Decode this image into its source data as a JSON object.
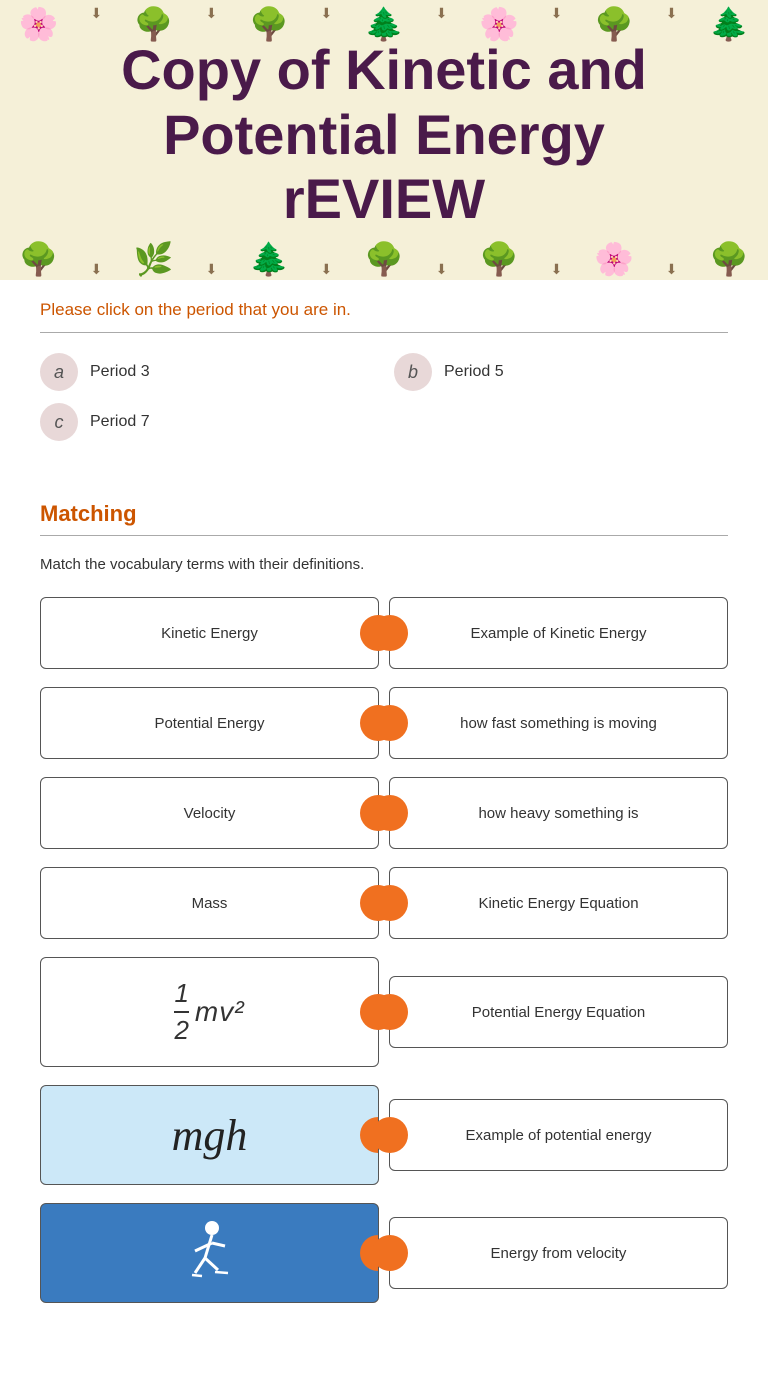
{
  "header": {
    "title": "Copy of Kinetic and Potential Energy rEVIEW"
  },
  "period_section": {
    "prompt": "Please click on the period that you are in.",
    "options": [
      {
        "badge": "a",
        "label": "Period 3"
      },
      {
        "badge": "b",
        "label": "Period 5"
      },
      {
        "badge": "c",
        "label": "Period 7"
      }
    ]
  },
  "matching": {
    "title": "Matching",
    "instruction": "Match the vocabulary terms with their definitions.",
    "left_items": [
      {
        "type": "text",
        "content": "Kinetic Energy"
      },
      {
        "type": "text",
        "content": "Potential Energy"
      },
      {
        "type": "text",
        "content": "Velocity"
      },
      {
        "type": "text",
        "content": "Mass"
      },
      {
        "type": "formula_ke",
        "content": "½mv²"
      },
      {
        "type": "formula_mgh",
        "content": "mgh"
      },
      {
        "type": "image_skier",
        "content": "skier"
      }
    ],
    "right_items": [
      {
        "content": "Example of Kinetic Energy"
      },
      {
        "content": "how fast something is moving"
      },
      {
        "content": "how heavy something is"
      },
      {
        "content": "Kinetic Energy Equation"
      },
      {
        "content": "Potential Energy Equation"
      },
      {
        "content": "Example of potential energy"
      },
      {
        "content": "Energy from velocity"
      }
    ]
  }
}
